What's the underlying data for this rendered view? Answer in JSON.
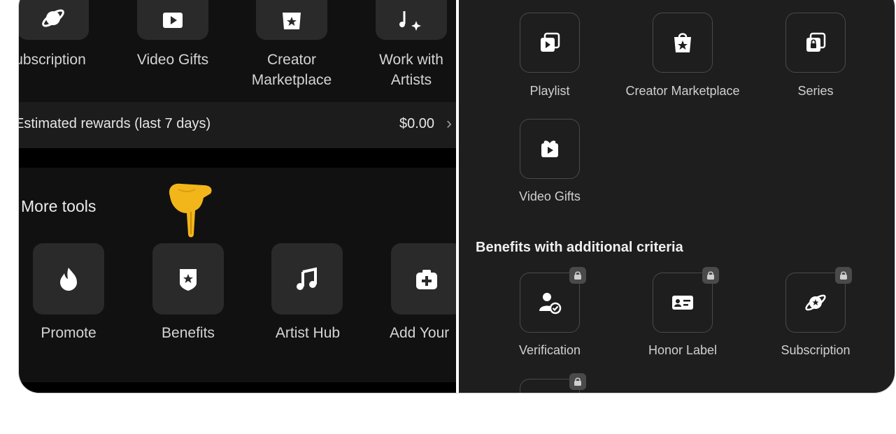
{
  "left": {
    "top_row": [
      {
        "label": "ubscription",
        "icon": "subscription-icon"
      },
      {
        "label": "Video Gifts",
        "icon": "video-gift-icon"
      },
      {
        "label_line1": "Creator",
        "label_line2": "Marketplace",
        "icon": "shopping-bag-star-icon"
      },
      {
        "label_line1": "Work with",
        "label_line2": "Artists",
        "icon": "music-sparkle-icon"
      }
    ],
    "rewards": {
      "label": "Estimated rewards (last 7 days)",
      "value": "$0.00"
    },
    "more_tools": {
      "title": "More tools",
      "items": [
        {
          "label": "Promote",
          "icon": "flame-icon"
        },
        {
          "label": "Benefits",
          "icon": "benefits-badge-icon"
        },
        {
          "label": "Artist Hub",
          "icon": "music-note-icon"
        },
        {
          "label": "Add Your",
          "icon": "add-plus-icon"
        }
      ]
    },
    "pointer": {
      "icon": "pointing-hand-emoji"
    }
  },
  "right": {
    "tools": [
      {
        "label": "Playlist",
        "icon": "playlist-icon"
      },
      {
        "label": "Creator Marketplace",
        "icon": "shopping-bag-star-icon"
      },
      {
        "label": "Series",
        "icon": "series-icon"
      },
      {
        "label": "Video Gifts",
        "icon": "video-gift-icon"
      }
    ],
    "benefits": {
      "title": "Benefits with additional criteria",
      "items": [
        {
          "label": "Verification",
          "icon": "verified-user-icon",
          "locked": true
        },
        {
          "label": "Honor Label",
          "icon": "id-card-icon",
          "locked": true
        },
        {
          "label": "Subscription",
          "icon": "subscription-icon",
          "locked": true
        }
      ]
    }
  },
  "colors": {
    "left_bg": "#111111",
    "right_bg": "#1e1e1e",
    "tile": "#2a2a2a",
    "text": "#d4d4d4",
    "pointer": "#f3b61a"
  }
}
